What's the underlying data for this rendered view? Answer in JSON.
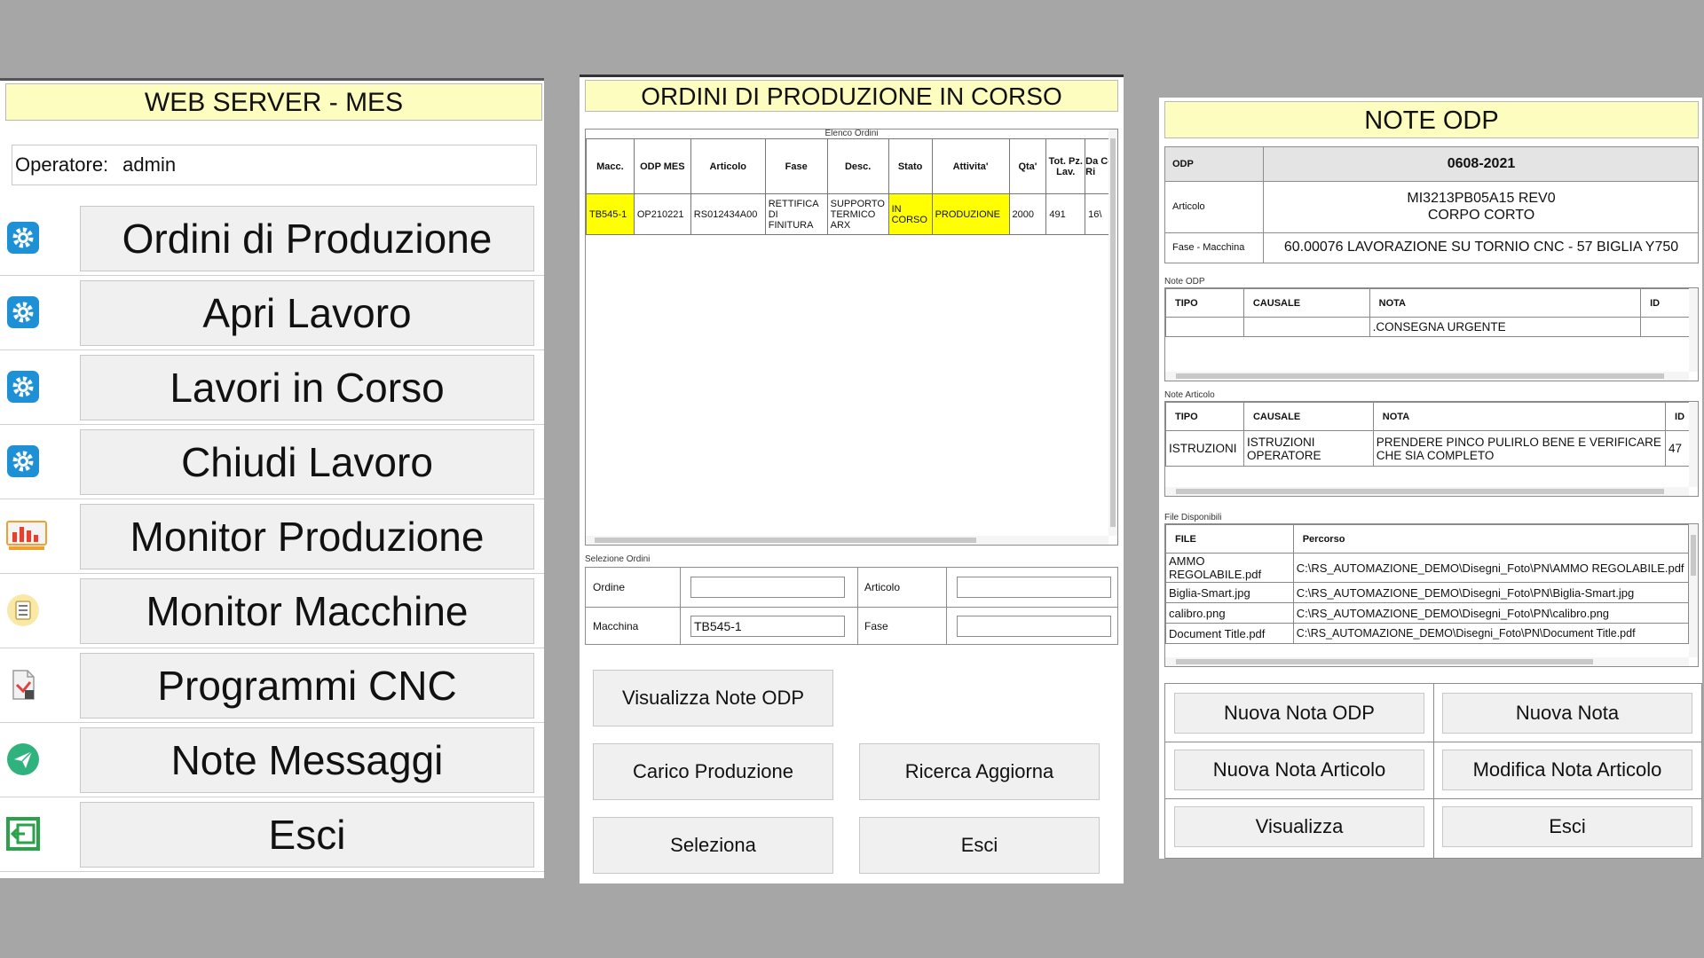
{
  "left": {
    "title": "WEB SERVER - MES",
    "operator_label": "Operatore:",
    "operator_value": "admin",
    "menu": [
      {
        "label": "Ordini di Produzione",
        "icon": "gear-icon"
      },
      {
        "label": "Apri Lavoro",
        "icon": "gear-icon"
      },
      {
        "label": "Lavori in Corso",
        "icon": "gear-icon"
      },
      {
        "label": "Chiudi Lavoro",
        "icon": "gear-icon"
      },
      {
        "label": "Monitor Produzione",
        "icon": "monitor-chart-icon"
      },
      {
        "label": "Monitor Macchine",
        "icon": "list-icon"
      },
      {
        "label": "Programmi CNC",
        "icon": "document-icon"
      },
      {
        "label": "Note Messaggi",
        "icon": "send-icon"
      },
      {
        "label": "Esci",
        "icon": "exit-icon"
      }
    ]
  },
  "middle": {
    "title": "ORDINI DI PRODUZIONE IN CORSO",
    "orders_group_label": "Elenco Ordini",
    "orders_columns": [
      "Macc.",
      "ODP MES",
      "Articolo",
      "Fase",
      "Desc.",
      "Stato",
      "Attivita'",
      "Qta'",
      "Tot. Pz. Lav.",
      "Da Co Ri"
    ],
    "orders_rows": [
      [
        "TB545-1",
        "OP210221",
        "RS012434A00",
        "RETTIFICA DI FINITURA",
        "SUPPORTO TERMICO ARX",
        "IN CORSO",
        "PRODUZIONE",
        "2000",
        "491",
        "16\\"
      ]
    ],
    "selection_group_label": "Selezione Ordini",
    "selection": {
      "ordine_label": "Ordine",
      "ordine_value": "",
      "articolo_label": "Articolo",
      "articolo_value": "",
      "macchina_label": "Macchina",
      "macchina_value": "TB545-1",
      "fase_label": "Fase",
      "fase_value": ""
    },
    "buttons": {
      "visualizza_note": "Visualizza Note ODP",
      "carico_produzione": "Carico Produzione",
      "ricerca_aggiorna": "Ricerca Aggiorna",
      "seleziona": "Seleziona",
      "esci": "Esci"
    }
  },
  "right": {
    "title": "NOTE ODP",
    "odp_label": "ODP",
    "odp_value": "0608-2021",
    "articolo_label": "Articolo",
    "articolo_line1": "MI3213PB05A15 REV0",
    "articolo_line2": "CORPO CORTO",
    "fase_label": "Fase - Macchina",
    "fase_value": "60.00076 LAVORAZIONE SU TORNIO CNC - 57 BIGLIA Y750",
    "note_odp_label": "Note ODP",
    "note_odp_columns": [
      "TIPO",
      "CAUSALE",
      "NOTA",
      "ID"
    ],
    "note_odp_rows": [
      [
        "",
        "",
        ".CONSEGNA URGENTE",
        ""
      ]
    ],
    "note_articolo_label": "Note Articolo",
    "note_articolo_columns": [
      "TIPO",
      "CAUSALE",
      "NOTA",
      "ID"
    ],
    "note_articolo_rows": [
      [
        "ISTRUZIONI",
        "ISTRUZIONI OPERATORE",
        "PRENDERE PINCO PULIRLO BENE E VERIFICARE CHE SIA COMPLETO",
        "47"
      ]
    ],
    "files_label": "File Disponibili",
    "files_columns": [
      "FILE",
      "Percorso"
    ],
    "files_rows": [
      [
        "AMMO REGOLABILE.pdf",
        "C:\\RS_AUTOMAZIONE_DEMO\\Disegni_Foto\\PN\\AMMO REGOLABILE.pdf"
      ],
      [
        "Biglia-Smart.jpg",
        "C:\\RS_AUTOMAZIONE_DEMO\\Disegni_Foto\\PN\\Biglia-Smart.jpg"
      ],
      [
        "calibro.png",
        "C:\\RS_AUTOMAZIONE_DEMO\\Disegni_Foto\\PN\\calibro.png"
      ],
      [
        "Document Title.pdf",
        "C:\\RS_AUTOMAZIONE_DEMO\\Disegni_Foto\\PN\\Document Title.pdf"
      ]
    ],
    "buttons": {
      "nuova_nota_odp": "Nuova Nota ODP",
      "nuova_nota": "Nuova Nota",
      "nuova_nota_articolo": "Nuova Nota Articolo",
      "modifica_nota_articolo": "Modifica Nota Articolo",
      "visualizza": "Visualizza",
      "esci": "Esci"
    }
  },
  "colors": {
    "background": "#a6a6a6",
    "title_bar": "#fdfdc0",
    "highlight_yellow": "#ffff00",
    "icon_blue": "#1e90d6",
    "button_bg": "#f0f0f0"
  }
}
